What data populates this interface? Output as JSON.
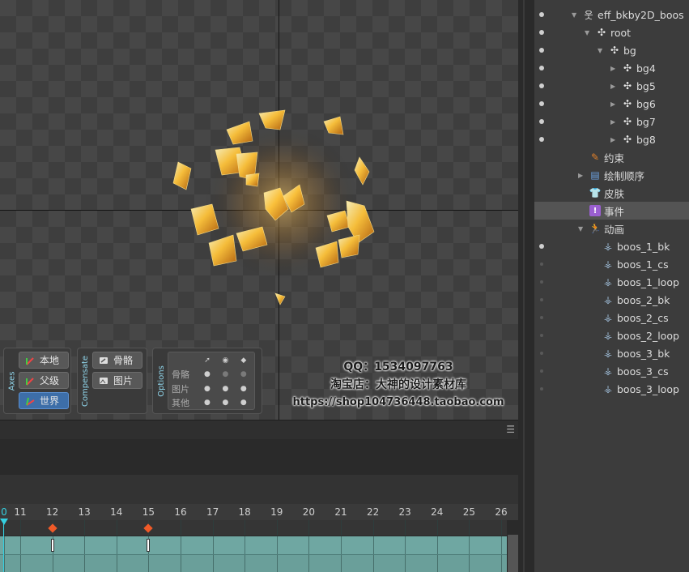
{
  "watermark": {
    "qq": "QQ：1534097763",
    "shop": "淘宝店：大神的设计素材库",
    "url": "https://shop104736448.taobao.com"
  },
  "axes_group": {
    "title": "Axes",
    "buttons": [
      {
        "label": "本地",
        "icon": "axes-local-icon",
        "active": false
      },
      {
        "label": "父级",
        "icon": "axes-parent-icon",
        "active": false
      },
      {
        "label": "世界",
        "icon": "axes-world-icon",
        "active": true
      }
    ]
  },
  "compensate_group": {
    "title": "Compensate",
    "buttons": [
      {
        "label": "骨骼",
        "icon": "bone-icon"
      },
      {
        "label": "图片",
        "icon": "image-icon"
      }
    ]
  },
  "options_group": {
    "title": "Options",
    "header_icons": [
      "pointer-icon",
      "eye-icon",
      "tag-icon"
    ],
    "rows": [
      {
        "label": "骨骼",
        "states": [
          true,
          true,
          false
        ]
      },
      {
        "label": "图片",
        "states": [
          true,
          true,
          true
        ]
      },
      {
        "label": "其他",
        "states": [
          true,
          true,
          true
        ]
      }
    ]
  },
  "tree": {
    "items": [
      {
        "label": "eff_bkby2D_boos",
        "icon": "skeleton-icon",
        "eye": true,
        "arrow": "down"
      },
      {
        "label": "root",
        "icon": "bone-icon",
        "eye": true,
        "arrow": "down"
      },
      {
        "label": "bg",
        "icon": "bone-icon",
        "eye": true,
        "arrow": "down"
      },
      {
        "label": "bg4",
        "icon": "bone-icon",
        "eye": true,
        "arrow": "right"
      },
      {
        "label": "bg5",
        "icon": "bone-icon",
        "eye": true,
        "arrow": "right"
      },
      {
        "label": "bg6",
        "icon": "bone-icon",
        "eye": true,
        "arrow": "right"
      },
      {
        "label": "bg7",
        "icon": "bone-icon",
        "eye": true,
        "arrow": "right"
      },
      {
        "label": "bg8",
        "icon": "bone-icon",
        "eye": true,
        "arrow": "right"
      },
      {
        "label": "约束",
        "icon": "constraint-icon",
        "eye": false,
        "arrow": ""
      },
      {
        "label": "绘制顺序",
        "icon": "draw-order-icon",
        "eye": false,
        "arrow": "right"
      },
      {
        "label": "皮肤",
        "icon": "skin-icon",
        "eye": false,
        "arrow": ""
      },
      {
        "label": "事件",
        "icon": "event-icon",
        "eye": false,
        "arrow": "",
        "selected": true
      },
      {
        "label": "动画",
        "icon": "animation-icon",
        "eye": false,
        "arrow": "down"
      },
      {
        "label": "boos_1_bk",
        "icon": "animation-clip-icon",
        "eye": true,
        "arrow": ""
      },
      {
        "label": "boos_1_cs",
        "icon": "animation-clip-icon",
        "eye": "off",
        "arrow": ""
      },
      {
        "label": "boos_1_loop",
        "icon": "animation-clip-icon",
        "eye": "off",
        "arrow": ""
      },
      {
        "label": "boos_2_bk",
        "icon": "animation-clip-icon",
        "eye": "off",
        "arrow": ""
      },
      {
        "label": "boos_2_cs",
        "icon": "animation-clip-icon",
        "eye": "off",
        "arrow": ""
      },
      {
        "label": "boos_2_loop",
        "icon": "animation-clip-icon",
        "eye": "off",
        "arrow": ""
      },
      {
        "label": "boos_3_bk",
        "icon": "animation-clip-icon",
        "eye": "off",
        "arrow": ""
      },
      {
        "label": "boos_3_cs",
        "icon": "animation-clip-icon",
        "eye": "off",
        "arrow": ""
      },
      {
        "label": "boos_3_loop",
        "icon": "animation-clip-icon",
        "eye": "off",
        "arrow": ""
      }
    ]
  },
  "timeline": {
    "ruler_ticks": [
      "0",
      "11",
      "12",
      "13",
      "14",
      "15",
      "16",
      "17",
      "18",
      "19",
      "20",
      "21",
      "22",
      "23",
      "24",
      "25",
      "26"
    ],
    "current_frame": "0",
    "keyframes": [
      "12",
      "15"
    ],
    "menu_icon": "menu-icon"
  },
  "colors": {
    "accent": "#35d0e0",
    "key": "#f05a28",
    "track": "#6fa7a2",
    "active_button": "#3d6ea8"
  }
}
